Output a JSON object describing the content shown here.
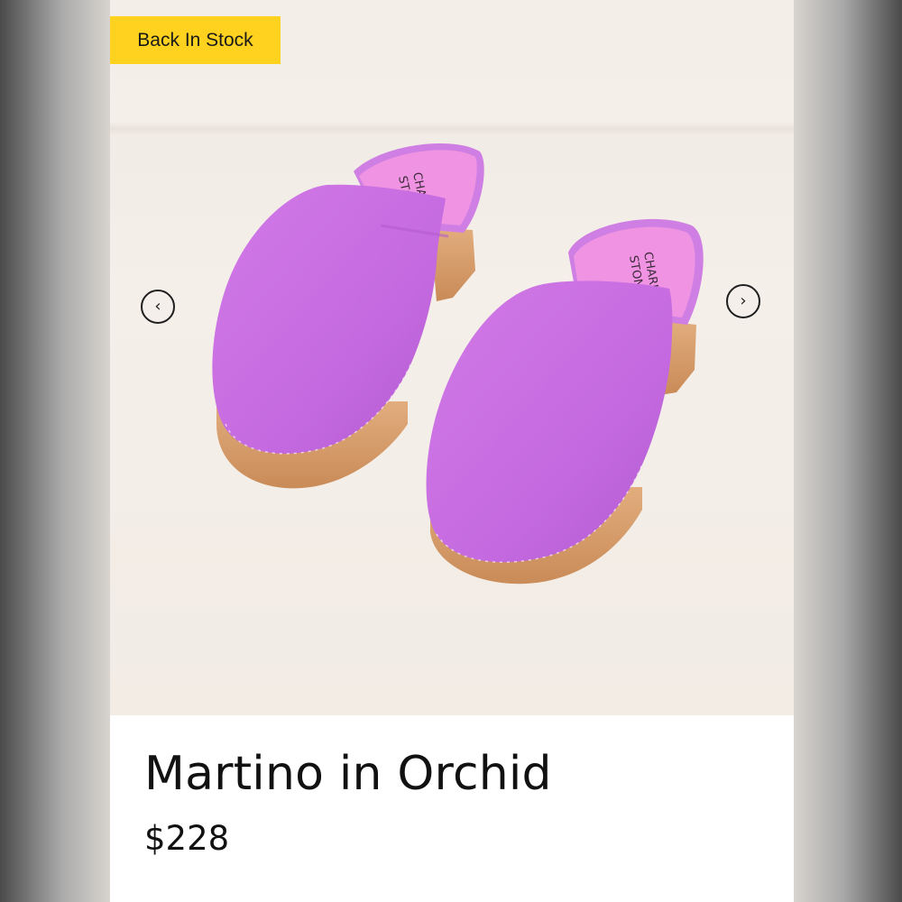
{
  "product": {
    "badge": "Back In Stock",
    "title": "Martino in Orchid",
    "price": "$228",
    "image": {
      "insole_brand_line1": "CHARLOTTE",
      "insole_brand_line2": "STONE",
      "colors": {
        "suede": "#c56ae0",
        "insole": "#ef93e2",
        "wood": "#d99e6d",
        "badge": "#ffd21f"
      }
    }
  },
  "carousel": {
    "prev_icon": "chevron-left-icon",
    "next_icon": "chevron-right-icon",
    "prev_glyph": "‹",
    "next_glyph": "›"
  }
}
